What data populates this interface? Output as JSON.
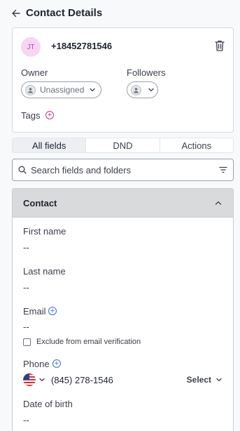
{
  "header": {
    "title": "Contact Details"
  },
  "contact": {
    "initials": "JT",
    "phone": "+18452781546",
    "owner_label": "Owner",
    "owner_value": "Unassigned",
    "followers_label": "Followers",
    "tags_label": "Tags"
  },
  "tabs": [
    {
      "label": "All fields",
      "active": true
    },
    {
      "label": "DND",
      "active": false
    },
    {
      "label": "Actions",
      "active": false
    }
  ],
  "search": {
    "placeholder": "Search fields and folders"
  },
  "section": {
    "title": "Contact",
    "fields": {
      "first_name": {
        "label": "First name",
        "value": "--"
      },
      "last_name": {
        "label": "Last name",
        "value": "--"
      },
      "email": {
        "label": "Email",
        "value": "--",
        "exclude_label": "Exclude from email verification"
      },
      "phone": {
        "label": "Phone",
        "value": "(845) 278-1546",
        "type_label": "Select"
      },
      "dob": {
        "label": "Date of birth",
        "value": "--"
      }
    }
  },
  "colors": {
    "avatar_bg": "#f6d6f1",
    "tag_plus": "#c2368f",
    "field_plus": "#3b6fd8",
    "section_head": "#d9dadc"
  }
}
